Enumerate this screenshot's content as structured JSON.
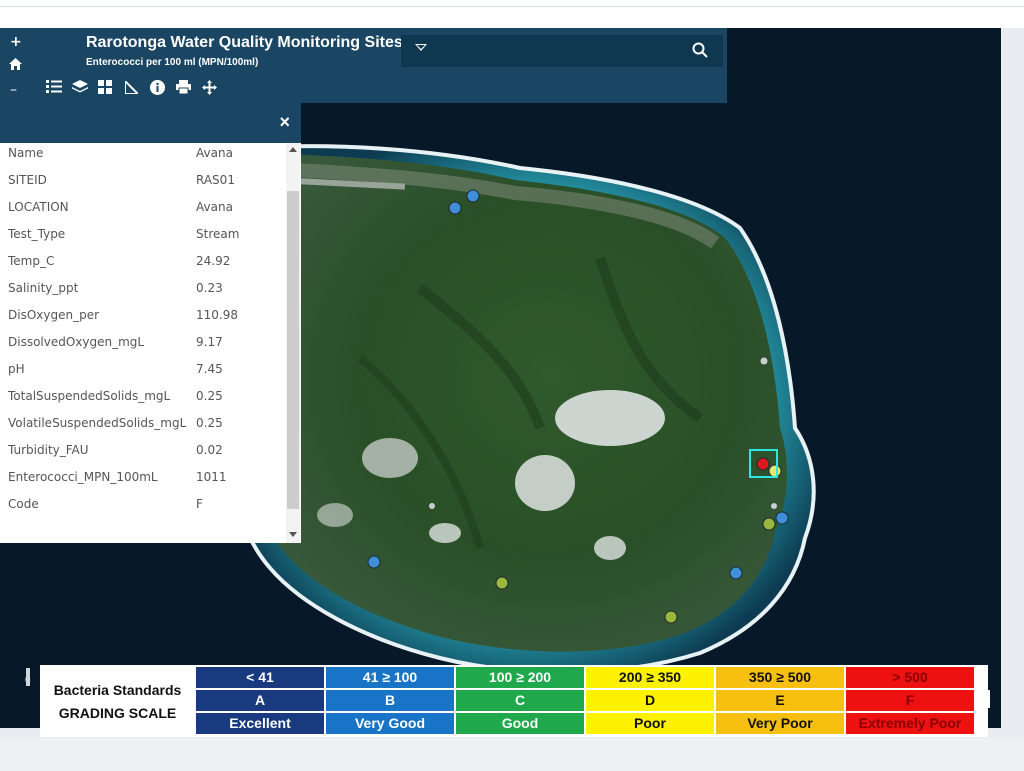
{
  "toolbar": {
    "title": "Rarotonga Water Quality Monitoring Sites",
    "subtitle": "Enterococci per 100 ml (MPN/100ml)",
    "search_placeholder": "",
    "icons": [
      "plus-icon",
      "home-icon",
      "minus-icon",
      "list-icon",
      "layers-icon",
      "basemap-gallery-icon",
      "measure-icon",
      "info-icon",
      "print-icon",
      "directions-icon",
      "dropdown-caret-icon",
      "search-icon"
    ]
  },
  "popup": {
    "close_label": "×",
    "fields": [
      {
        "key": "Name",
        "value": "Avana"
      },
      {
        "key": "SITEID",
        "value": "RAS01"
      },
      {
        "key": "LOCATION",
        "value": "Avana"
      },
      {
        "key": "Test_Type",
        "value": "Stream"
      },
      {
        "key": "Temp_C",
        "value": "24.92"
      },
      {
        "key": "Salinity_ppt",
        "value": "0.23"
      },
      {
        "key": "DisOxygen_per",
        "value": "110.98"
      },
      {
        "key": "DissolvedOxygen_mgL",
        "value": "9.17"
      },
      {
        "key": "pH",
        "value": "7.45"
      },
      {
        "key": "TotalSuspendedSolids_mgL",
        "value": "0.25"
      },
      {
        "key": "VolatileSuspendedSolids_mgL",
        "value": "0.25"
      },
      {
        "key": "Turbidity_FAU",
        "value": "0.02"
      },
      {
        "key": "Enterococci_MPN_100mL",
        "value": "1011"
      },
      {
        "key": "Code",
        "value": "F"
      }
    ]
  },
  "legend": {
    "title_line1": "Bacteria Standards",
    "title_line2": "GRADING SCALE",
    "grades": [
      {
        "range": "< 41",
        "code": "A",
        "label": "Excellent",
        "color": "#1a3a80",
        "text": "#ffffff"
      },
      {
        "range": "41 ≥ 100",
        "code": "B",
        "label": "Very Good",
        "color": "#1874c6",
        "text": "#ffffff"
      },
      {
        "range": "100 ≥ 200",
        "code": "C",
        "label": "Good",
        "color": "#1fa84c",
        "text": "#ffffff"
      },
      {
        "range": "200 ≥ 350",
        "code": "D",
        "label": "Poor",
        "color": "#fff200",
        "text": "#111111"
      },
      {
        "range": "350 ≥ 500",
        "code": "E",
        "label": "Very Poor",
        "color": "#f7c011",
        "text": "#111111"
      },
      {
        "range": "> 500",
        "code": "F",
        "label": "Extremely Poor",
        "color": "#ee1111",
        "text": "#8a0000"
      }
    ]
  },
  "scale_zero": "0",
  "map": {
    "sites": [
      {
        "grade": "B"
      },
      {
        "grade": "B"
      },
      {
        "grade": "B"
      },
      {
        "grade": "C"
      },
      {
        "grade": "C"
      },
      {
        "grade": "B"
      },
      {
        "grade": "B"
      },
      {
        "grade": "C"
      },
      {
        "grade": "F",
        "selected": true
      },
      {
        "grade": "D"
      }
    ]
  }
}
